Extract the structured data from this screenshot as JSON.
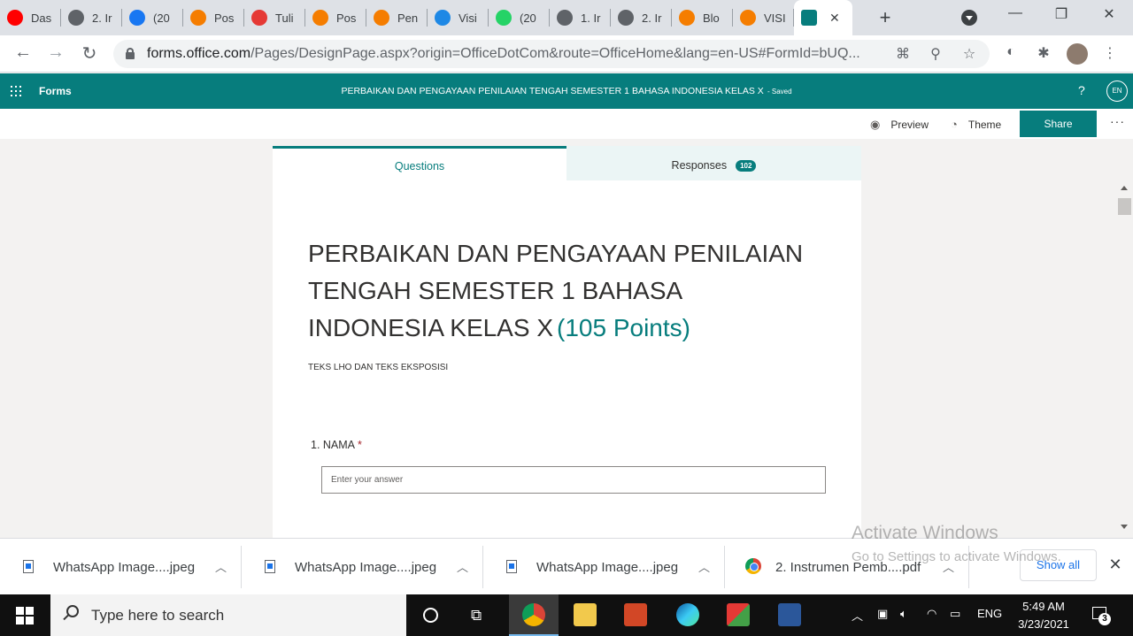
{
  "browser": {
    "tabs": [
      {
        "label": "Das",
        "icon": "youtube-icon",
        "color": "#ff0000"
      },
      {
        "label": "2. Ir",
        "icon": "globe-icon",
        "color": "#5f6368"
      },
      {
        "label": "(20",
        "icon": "facebook-icon",
        "color": "#1877f2"
      },
      {
        "label": "Pos",
        "icon": "blogger-icon",
        "color": "#f57d00"
      },
      {
        "label": "Tuli",
        "icon": "red-app-icon",
        "color": "#e53935"
      },
      {
        "label": "Pos",
        "icon": "blogger-icon",
        "color": "#f57d00"
      },
      {
        "label": "Pen",
        "icon": "blogger-icon",
        "color": "#f57d00"
      },
      {
        "label": "Visi",
        "icon": "app-icon",
        "color": "#1e88e5"
      },
      {
        "label": "(20",
        "icon": "whatsapp-icon",
        "color": "#25d366"
      },
      {
        "label": "1. Ir",
        "icon": "globe-icon",
        "color": "#5f6368"
      },
      {
        "label": "2. Ir",
        "icon": "globe-icon",
        "color": "#5f6368"
      },
      {
        "label": "Blo",
        "icon": "blogger-icon",
        "color": "#f57d00"
      },
      {
        "label": "VISI",
        "icon": "blogger-icon",
        "color": "#f57d00"
      }
    ],
    "active_tab_icon": "forms-icon",
    "url_host": "forms.office.com",
    "url_rest": "/Pages/DesignPage.aspx?origin=OfficeDotCom&route=OfficeHome&lang=en-US#FormId=bUQ..."
  },
  "forms": {
    "app_name": "Forms",
    "doc_title": "PERBAIKAN DAN PENGAYAAN PENILAIAN TENGAH SEMESTER 1 BAHASA INDONESIA KELAS X",
    "saved": " - Saved",
    "help": "?",
    "avatar": "EN",
    "preview": "Preview",
    "theme": "Theme",
    "share": "Share",
    "more": "···",
    "tab_questions": "Questions",
    "tab_responses": "Responses",
    "responses_count": "102",
    "form_title": "PERBAIKAN DAN PENGAYAAN PENILAIAN TENGAH SEMESTER 1 BAHASA INDONESIA KELAS X",
    "points": "(105 Points)",
    "description": "TEKS LHO DAN TEKS EKSPOSISI",
    "question1_label": "1. NAMA",
    "required_mark": "*",
    "answer_placeholder": "Enter your answer"
  },
  "watermark": {
    "line1": "Activate Windows",
    "line2": "Go to Settings to activate Windows."
  },
  "downloads": {
    "items": [
      "WhatsApp Image....jpeg",
      "WhatsApp Image....jpeg",
      "WhatsApp Image....jpeg",
      "2. Instrumen Pemb....pdf"
    ],
    "show_all": "Show all"
  },
  "taskbar": {
    "search_placeholder": "Type here to search",
    "lang": "ENG",
    "time": "5:49 AM",
    "date": "3/23/2021",
    "notifications": "3"
  },
  "colors": {
    "accent": "#077d7d",
    "required": "#a4262c"
  }
}
